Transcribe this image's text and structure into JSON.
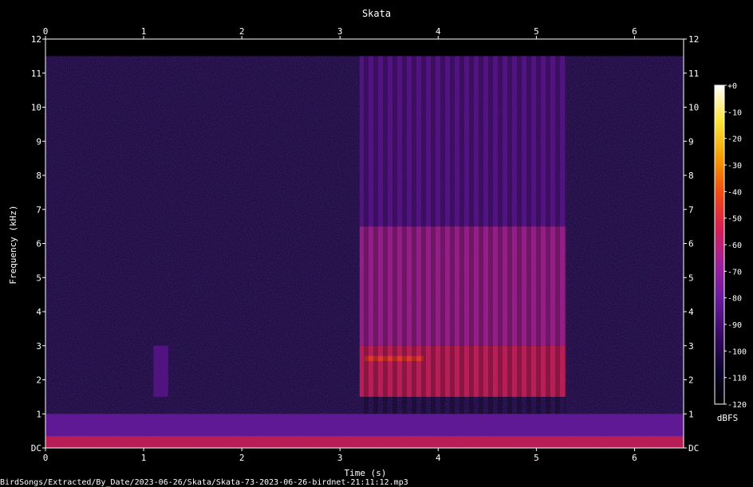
{
  "chart_data": {
    "type": "heatmap",
    "title": "Skata",
    "xlabel": "Time (s)",
    "ylabel": "Frequency (kHz)",
    "xlim": [
      0,
      6.5
    ],
    "ylim": [
      0,
      12
    ],
    "x_ticks": [
      "0",
      "1",
      "2",
      "3",
      "4",
      "5",
      "6"
    ],
    "x_tick_values": [
      0,
      1,
      2,
      3,
      4,
      5,
      6
    ],
    "y_ticks": [
      "DC",
      "1",
      "2",
      "3",
      "4",
      "5",
      "6",
      "7",
      "8",
      "9",
      "10",
      "11",
      "12"
    ],
    "y_tick_values": [
      0,
      1,
      2,
      3,
      4,
      5,
      6,
      7,
      8,
      9,
      10,
      11,
      12
    ],
    "colorbar": {
      "label": "dBFS",
      "ticks": [
        "+0",
        "-10",
        "-20",
        "-30",
        "-40",
        "-50",
        "-60",
        "-70",
        "-80",
        "-90",
        "-100",
        "-110",
        "-120"
      ],
      "tick_values": [
        0,
        -10,
        -20,
        -30,
        -40,
        -50,
        -60,
        -70,
        -80,
        -90,
        -100,
        -110,
        -120
      ],
      "range": [
        -120,
        0
      ],
      "colormap": [
        "#000000",
        "#0c0530",
        "#3a0a66",
        "#6a1aa0",
        "#a0209a",
        "#d8204f",
        "#f04d10",
        "#f5a000",
        "#fde63a",
        "#ffffff"
      ]
    },
    "regions": [
      {
        "t_start": 0,
        "t_end": 6.5,
        "f_low": 0,
        "f_high": 0.35,
        "dbfs": -55
      },
      {
        "t_start": 0,
        "t_end": 6.5,
        "f_low": 0.35,
        "f_high": 1.0,
        "dbfs": -80
      },
      {
        "t_start": 1.1,
        "t_end": 1.25,
        "f_low": 1.5,
        "f_high": 3.0,
        "dbfs": -85
      },
      {
        "t_start": 3.2,
        "t_end": 5.3,
        "f_low": 1.5,
        "f_high": 3.0,
        "dbfs": -55
      },
      {
        "t_start": 3.2,
        "t_end": 5.3,
        "f_low": 3.0,
        "f_high": 6.5,
        "dbfs": -65
      },
      {
        "t_start": 3.2,
        "t_end": 5.3,
        "f_low": 6.5,
        "f_high": 11.5,
        "dbfs": -85
      },
      {
        "t_start": 3.25,
        "t_end": 3.85,
        "f_low": 2.55,
        "f_high": 2.7,
        "dbfs": -45
      }
    ],
    "grid": false,
    "legend": "colorbar-right"
  },
  "footer": {
    "path": "BirdSongs/Extracted/By_Date/2023-06-26/Skata/Skata-73-2023-06-26-birdnet-21:11:12.mp3"
  }
}
